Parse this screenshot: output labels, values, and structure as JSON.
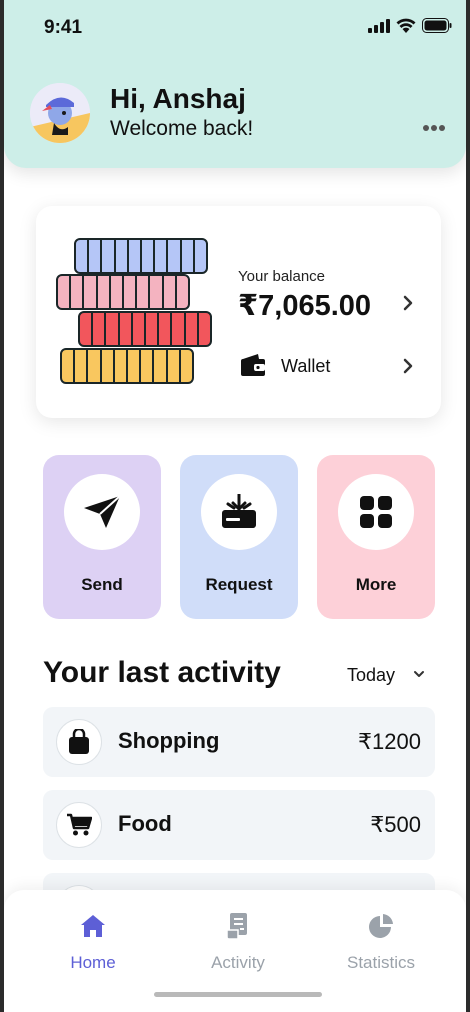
{
  "status_bar": {
    "time": "9:41",
    "icons": [
      "signal-icon",
      "wifi-icon",
      "battery-icon"
    ]
  },
  "header": {
    "greeting": "Hi, Anshaj",
    "subtitle": "Welcome back!",
    "menu_icon": "more-horizontal-icon"
  },
  "balance_card": {
    "label": "Your balance",
    "value": "₹7,065.00",
    "wallet_label": "Wallet",
    "illustration": "cash-stack-illustration"
  },
  "actions": [
    {
      "label": "Send",
      "icon": "send-icon",
      "color": "#ddd1f4"
    },
    {
      "label": "Request",
      "icon": "request-icon",
      "color": "#d0ddf9"
    },
    {
      "label": "More",
      "icon": "grid-icon",
      "color": "#fdd0d8"
    }
  ],
  "activity": {
    "title": "Your last activity",
    "period": "Today",
    "items": [
      {
        "name": "Shopping",
        "amount": "₹1200",
        "icon": "shopping-bag-icon"
      },
      {
        "name": "Food",
        "amount": "₹500",
        "icon": "cart-icon"
      }
    ]
  },
  "bottom_nav": {
    "items": [
      {
        "label": "Home",
        "icon": "home-icon",
        "active": true
      },
      {
        "label": "Activity",
        "icon": "receipt-icon",
        "active": false
      },
      {
        "label": "Statistics",
        "icon": "pie-chart-icon",
        "active": false
      }
    ]
  },
  "colors": {
    "header_bg": "#cdeee8",
    "accent": "#5d5fd6",
    "inactive": "#9ba2aa"
  }
}
